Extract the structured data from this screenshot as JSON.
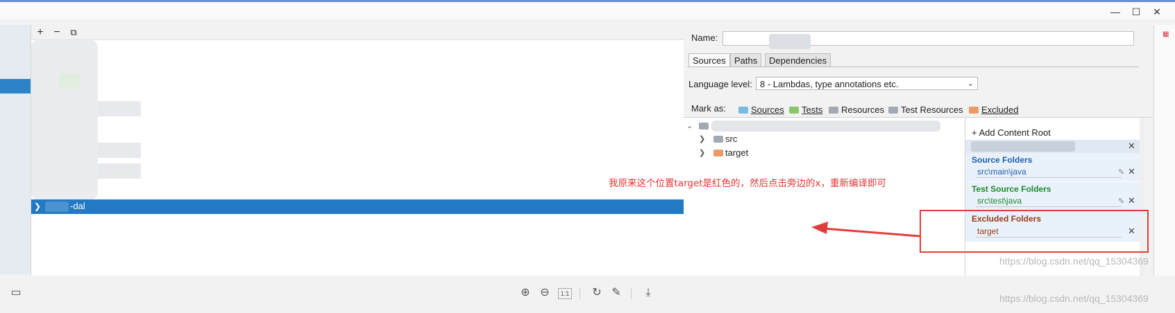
{
  "window": {
    "minimize_glyph": "—",
    "restore_glyph": "☐",
    "close_glyph": "✕"
  },
  "tree_toolbar": {
    "add": "+",
    "remove": "−",
    "copy": "⧉"
  },
  "tree": {
    "selected_module_suffix": "-dal"
  },
  "module": {
    "name_label": "Name:",
    "name_value": "",
    "tabs": [
      {
        "label": "Sources"
      },
      {
        "label": "Paths"
      },
      {
        "label": "Dependencies"
      }
    ],
    "language_level_label": "Language level:",
    "language_level_value": "8 - Lambdas, type annotations etc.",
    "mark_as_label": "Mark as:",
    "mark_as": [
      {
        "label": "Sources",
        "color": "#7ab9e0"
      },
      {
        "label": "Tests",
        "color": "#8cc46a"
      },
      {
        "label": "Resources",
        "color": "#a3a9b3"
      },
      {
        "label": "Test Resources",
        "color": "#a3a9b3"
      },
      {
        "label": "Excluded",
        "color": "#eb9a68"
      }
    ],
    "content_tree": [
      {
        "label": "src",
        "color": "#a3a9b3"
      },
      {
        "label": "target",
        "color": "#eb9a68"
      }
    ],
    "add_content_root": "+ Add Content Root",
    "source_folders": {
      "title": "Source Folders",
      "item": "src\\main\\java",
      "color": "#1f5fb0"
    },
    "test_source_folders": {
      "title": "Test Source Folders",
      "item": "src\\test\\java",
      "color": "#1e8a2e"
    },
    "excluded_folders": {
      "title": "Excluded Folders",
      "item": "target",
      "color": "#9b3a16"
    }
  },
  "annotation": {
    "text": "我原来这个位置target是红色的，然后点击旁边的x，重新编译即可",
    "color": "#e53333"
  },
  "watermark": "https://blog.csdn.net/qq_15304369",
  "bottom_toolbar": {
    "zoom_in": "⊕",
    "zoom_out": "⊖",
    "fit": "1:1",
    "rotate": "↻",
    "edit": "✎",
    "download": "⤓"
  }
}
